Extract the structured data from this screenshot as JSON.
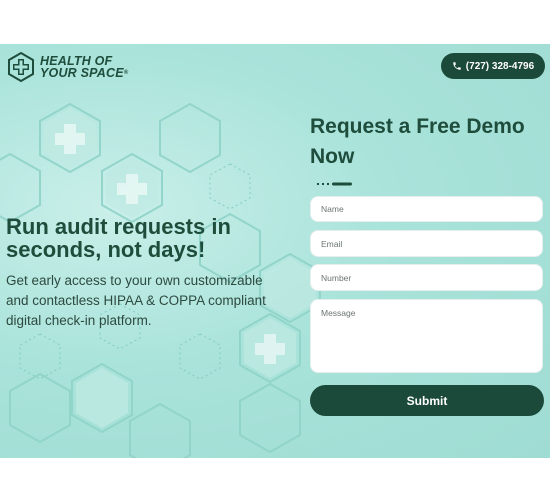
{
  "brand": {
    "line1": "HEALTH OF",
    "line2": "YOUR SPACE",
    "mark": "®",
    "logo_icon": "cross-hexagon-icon",
    "color": "#1f4d3c"
  },
  "header": {
    "phone_label": "(727) 328-4796",
    "phone_icon": "phone-icon"
  },
  "hero": {
    "headline": "Run audit requests in seconds, not days!",
    "subtext": "Get early access to your own customizable and contactless HIPAA & COPPA compliant digital check-in platform."
  },
  "form": {
    "title": "Request a Free Demo Now",
    "name_placeholder": "Name",
    "email_placeholder": "Email",
    "number_placeholder": "Number",
    "message_placeholder": "Message",
    "submit_label": "Submit"
  },
  "colors": {
    "primary": "#1c4a3a",
    "background": "#a9e3da",
    "text": "#1f4d3c"
  }
}
